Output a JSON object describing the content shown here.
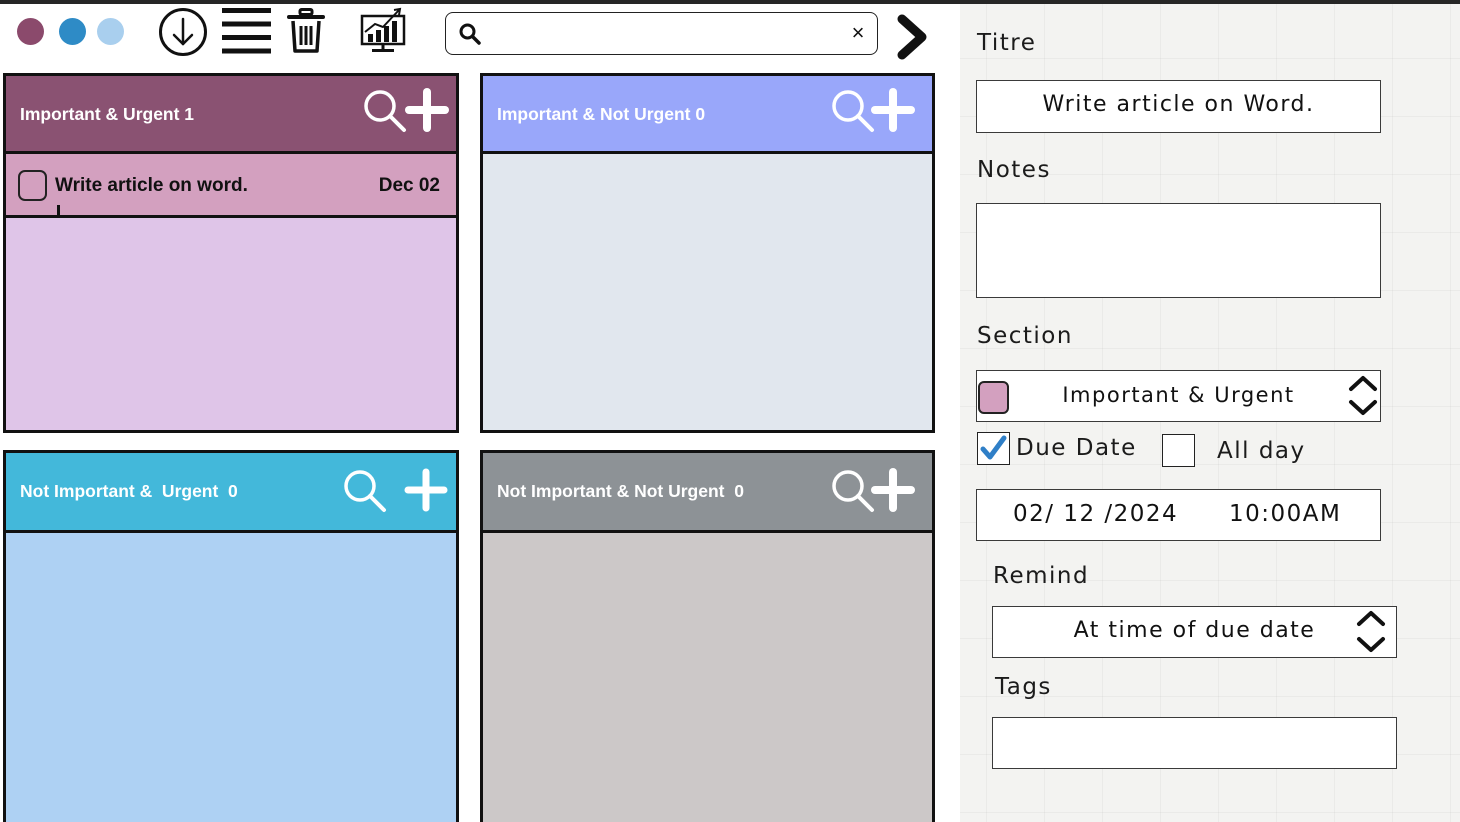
{
  "toolbar": {
    "window_dots": [
      "#8b4a6c",
      "#2e8bc6",
      "#a9cfee"
    ],
    "icons": [
      "download-icon",
      "menu-icon",
      "trash-icon",
      "chart-monitor-icon",
      "chevron-right-icon"
    ],
    "search": {
      "value": "",
      "placeholder": "",
      "clear_label": "×"
    }
  },
  "quadrants": [
    {
      "title": "Important & Urgent 1",
      "header_color": "#8a5272",
      "body_color": "#dfc5e8"
    },
    {
      "title": "Important & Not Urgent 0",
      "header_color": "#99a7fa",
      "body_color": "#e1e7ee"
    },
    {
      "title": "Not Important &  Urgent  0",
      "header_color": "#43b8da",
      "body_color": "#aed1f3"
    },
    {
      "title": "Not Important & Not Urgent  0",
      "header_color": "#8d9296",
      "body_color": "#ccc8c8"
    }
  ],
  "tasks": [
    {
      "title": "Write article on word.",
      "date": "Dec 02",
      "color": "#d3a0bf",
      "checked": false
    }
  ],
  "detail": {
    "titre_label": "Titre",
    "titre_value": "Write article on Word.",
    "notes_label": "Notes",
    "notes_value": "",
    "section_label": "Section",
    "section_value": "Important & Urgent",
    "section_color": "#d3a0bf",
    "due_date_label": "Due Date",
    "due_date_checked": true,
    "all_day_label": "All day",
    "all_day_checked": false,
    "date_value": "02/ 12 /2024",
    "time_value": "10:00AM",
    "remind_label": "Remind",
    "remind_value": "At time of due date",
    "tags_label": "Tags",
    "tags_value": ""
  }
}
